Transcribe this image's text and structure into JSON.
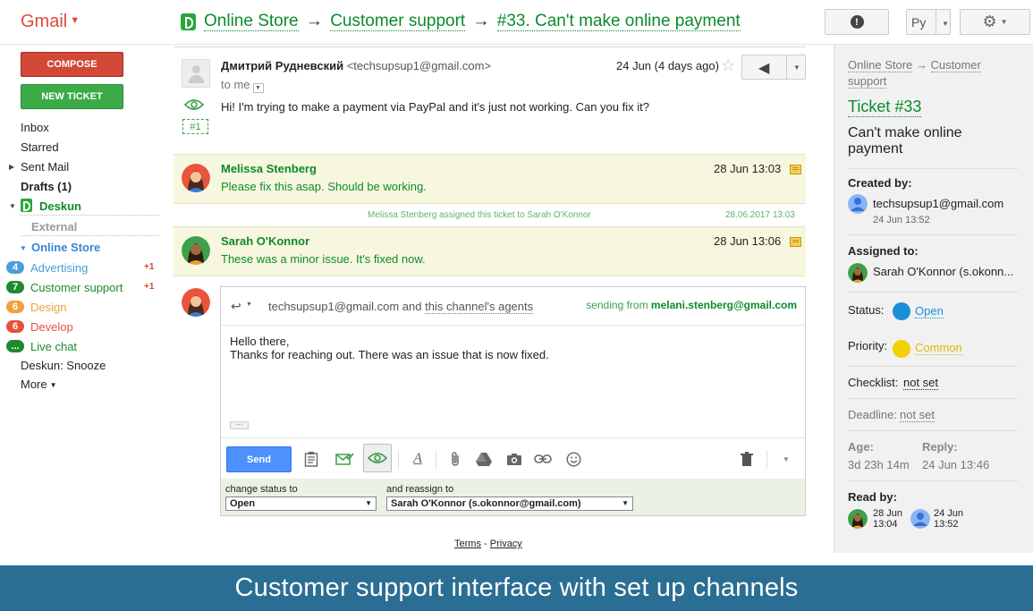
{
  "header": {
    "app": "Gmail",
    "crumbs": [
      "Online Store",
      "Customer support",
      "#33. Can't make online payment"
    ],
    "arrow": "→",
    "lang": "Ру"
  },
  "nav": {
    "compose": "COMPOSE",
    "new_ticket": "NEW TICKET",
    "items": [
      "Inbox",
      "Starred",
      "Sent Mail",
      "Drafts (1)",
      "Deskun"
    ],
    "external": "External",
    "online_store": "Online Store",
    "channels": [
      {
        "count": "4",
        "label": "Advertising",
        "plus": "+1",
        "color": "#4a9fd5"
      },
      {
        "count": "7",
        "label": "Customer support",
        "plus": "+1",
        "color": "#1e8a2d"
      },
      {
        "count": "6",
        "label": "Design",
        "plus": "",
        "color": "#f0a03c"
      },
      {
        "count": "6",
        "label": "Develop",
        "plus": "",
        "color": "#e8503c"
      },
      {
        "count": "...",
        "label": "Live chat",
        "plus": "",
        "color": "#1e8a2d"
      }
    ],
    "snooze": "Deskun: Snooze",
    "more": "More"
  },
  "thread": {
    "first": {
      "from": "Дмитрий Рудневский",
      "email": "<techsupsup1@gmail.com>",
      "date": "24 Jun (4 days ago)",
      "to": "to me",
      "tag": "#1",
      "body": "Hi! I'm trying to make a payment via PayPal and it's just not working. Can you fix it?"
    },
    "notes": [
      {
        "name": "Melissa Stenberg",
        "date": "28 Jun 13:03",
        "text": "Please fix this asap. Should be working."
      },
      {
        "name": "Sarah O'Konnor",
        "date": "28 Jun 13:06",
        "text": "These was a minor issue. It's fixed now."
      }
    ],
    "system": {
      "text": "Melissa Stenberg assigned this ticket to Sarah O'Konnor",
      "date": "28.06.2017 13:03"
    }
  },
  "reply": {
    "to_email": "techsupsup1@gmail.com",
    "and": "and",
    "to_agents": "this channel's agents",
    "sending_from_label": "sending from",
    "sending_from": "melani.stenberg@gmail.com",
    "body_line1": "Hello there,",
    "body_line2": "Thanks for reaching out. There was an issue that is now fixed.",
    "more": "···",
    "send": "Send",
    "status_label": "change status to",
    "status_value": "Open",
    "assign_label": "and reassign to",
    "assign_value": "Sarah O'Konnor (s.okonnor@gmail.com)"
  },
  "footer": {
    "terms": "Terms",
    "dash": "-",
    "privacy": "Privacy"
  },
  "panel": {
    "crumb1": "Online Store",
    "crumb_arrow": "→",
    "crumb2": "Customer",
    "crumb3": "support",
    "ticket": "Ticket #33",
    "subject": "Can't make online payment",
    "created_label": "Created by:",
    "created_by": "techsupsup1@gmail.com",
    "created_date": "24 Jun 13:52",
    "assigned_label": "Assigned to:",
    "assigned_to": "Sarah O'Konnor (s.okonn...",
    "status_label": "Status:",
    "status": "Open",
    "priority_label": "Priority:",
    "priority": "Common",
    "checklist_label": "Checklist:",
    "checklist": "not set",
    "deadline_label": "Deadline:",
    "deadline": "not set",
    "age_label": "Age:",
    "age": "3d 23h 14m",
    "reply_label": "Reply:",
    "reply": "24 Jun 13:46",
    "readby_label": "Read by:",
    "readby": [
      {
        "line1": "28 Jun",
        "line2": "13:04"
      },
      {
        "line1": "24 Jun",
        "line2": "13:52"
      }
    ],
    "status_color": "#1a8fd8",
    "priority_color": "#f4d000"
  },
  "caption": "Customer support interface with set up channels"
}
